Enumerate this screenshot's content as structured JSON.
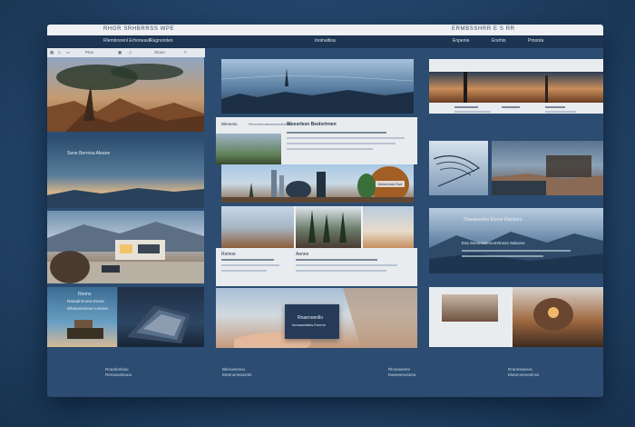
{
  "window": {
    "title_left": "RHGR SRHBRRSS WPE",
    "title_right": "ERMBSSHRR E S RR"
  },
  "navbar": {
    "item_1": "Rlembrsrenl Erhoneaslt",
    "item_2": "Ragnoniteo",
    "item_3": "Inoinaltioa",
    "item_4": "Enpenie",
    "item_5": "Ersrhis",
    "item_6": "Pmonta"
  },
  "toolbar": {
    "item_1": "Ptos",
    "item_2": "Stono"
  },
  "left": {
    "landscape_caption": "Sene Berrnsa Aleane",
    "harbor_caption_1": "Renne",
    "harbor_caption_2": "Raeadnnnoss Eerao",
    "harbor_caption_3": "Wlatoennseoe Lnneoe"
  },
  "middle": {
    "article_label": "Blenesto",
    "article_sub": "Rerenmenasnessesfesnes",
    "article_title": "Wossrlesn Beolsrtrnen",
    "city_tag": "Aenenoos Son",
    "city_caption_1": "Rsmoe",
    "city_caption_2": "Aenee",
    "popup_title": "Rnaenoenllo",
    "popup_sub": "Iennaoeabes Eunmn"
  },
  "right": {
    "banner_title": "Osaatnenlno Elsesr Rarrpnrs",
    "banner_sub": "Esa Ssesrroteenomrtnoss Saloono"
  },
  "footer": {
    "col_1": [
      "Rraedenlsao",
      "Renasoeleuna"
    ],
    "col_2": [
      "Blenoeerseo",
      "Eteenoneaosnln"
    ],
    "col_3": [
      "Rlonaseene",
      "Eaeeeenoseea"
    ],
    "col_4": [
      "Rraneseanos",
      "Elasnoneneelnss"
    ]
  },
  "colors": {
    "frame": "#2c4d71",
    "titlebar": "#eef0f3",
    "navbar": "#1d3452",
    "panel": "#e9ecef"
  }
}
